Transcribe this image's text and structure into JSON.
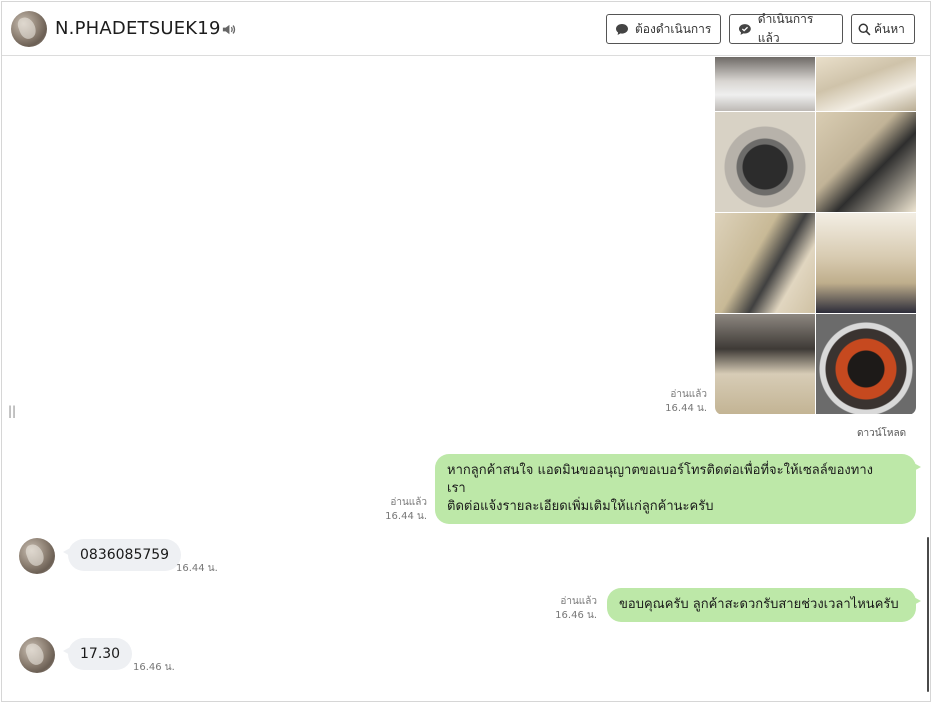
{
  "header": {
    "name": "N.PHADETSUEK19",
    "buttons": {
      "todo": "ต้องดำเนินการ",
      "done": "ดำเนินการแล้ว",
      "search": "ค้นหา"
    }
  },
  "chat": {
    "image_message": {
      "read_label": "อ่านแล้ว",
      "time": "16.44 น.",
      "download_label": "ดาวน์โหลด",
      "photo_count": 8
    },
    "messages": [
      {
        "direction": "out",
        "read_label": "อ่านแล้ว",
        "time": "16.44 น.",
        "lines": [
          "หากลูกค้าสนใจ แอดมินขออนุญาตขอเบอร์โทรติดต่อเพื่อที่จะให้เซลล์ของทาง",
          "เรา",
          "ติดต่อแจ้งรายละเอียดเพิ่มเติมให้แก่ลูกค้านะครับ"
        ]
      },
      {
        "direction": "in",
        "text": "0836085759",
        "time": "16.44 น."
      },
      {
        "direction": "out",
        "read_label": "อ่านแล้ว",
        "time": "16.46 น.",
        "text": "ขอบคุณครับ ลูกค้าสะดวกรับสายช่วงเวลาไหนครับ"
      },
      {
        "direction": "in",
        "text": "17.30",
        "time": "16.46 น."
      }
    ]
  },
  "colors": {
    "outgoing_bubble": "#bde8a8",
    "incoming_bubble": "#eef0f3",
    "border": "#d6d6d6"
  },
  "icons": [
    "speaker-icon",
    "chat-bubble-icon",
    "search-icon"
  ]
}
